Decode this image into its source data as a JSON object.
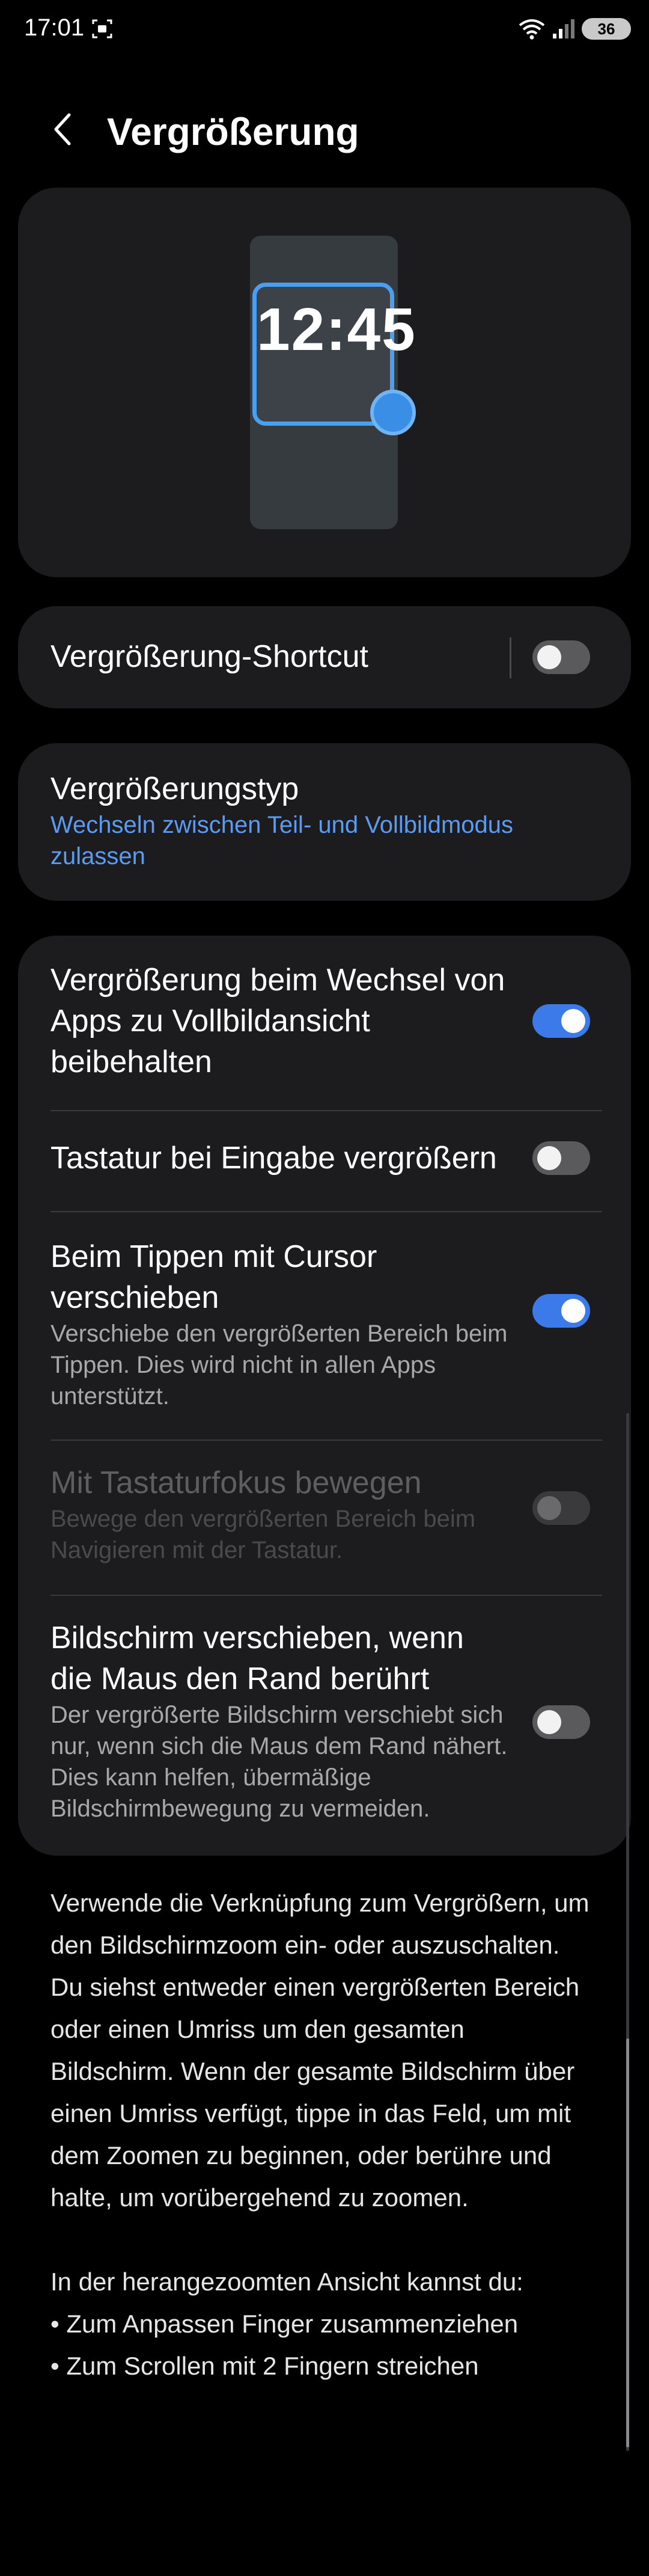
{
  "status": {
    "time": "17:01",
    "battery": "36"
  },
  "header": {
    "title": "Vergrößerung"
  },
  "preview": {
    "time": "12:45"
  },
  "shortcut": {
    "label": "Vergrößerung-Shortcut",
    "enabled": false
  },
  "type": {
    "title": "Vergrößerungstyp",
    "subtitle": "Wechseln zwischen Teil- und Vollbildmodus zulassen"
  },
  "settings": [
    {
      "title": "Vergrößerung beim Wechsel von Apps zu Vollbildansicht beibehalten",
      "subtitle": "",
      "enabled": true,
      "disabled": false
    },
    {
      "title": "Tastatur bei Eingabe vergrößern",
      "subtitle": "",
      "enabled": false,
      "disabled": false
    },
    {
      "title": "Beim Tippen mit Cursor verschieben",
      "subtitle": "Verschiebe den vergrößerten Bereich beim Tippen. Dies wird nicht in allen Apps unterstützt.",
      "enabled": true,
      "disabled": false
    },
    {
      "title": "Mit Tastaturfokus bewegen",
      "subtitle": "Bewege den vergrößerten Bereich beim Navigieren mit der Tastatur.",
      "enabled": false,
      "disabled": true
    },
    {
      "title": "Bildschirm verschieben, wenn die Maus den Rand berührt",
      "subtitle": "Der vergrößerte Bildschirm verschiebt sich nur, wenn sich die Maus dem Rand nähert. Dies kann helfen, übermäßige Bildschirmbewegung zu vermeiden.",
      "enabled": false,
      "disabled": false
    }
  ],
  "description": {
    "paragraph1": "Verwende die Verknüpfung zum Vergrößern, um den Bildschirmzoom ein- oder auszuschalten. Du siehst entweder einen vergrößerten Bereich oder einen Umriss um den gesamten Bildschirm. Wenn der gesamte Bildschirm über einen Umriss verfügt, tippe in das Feld, um mit dem Zoomen zu beginnen, oder berühre und halte, um vorübergehend zu zoomen.",
    "paragraph2": "In der herangezoomten Ansicht kannst du:",
    "bullet1": "• Zum Anpassen Finger zusammenziehen",
    "bullet2": "• Zum Scrollen mit 2 Fingern streichen"
  },
  "colors": {
    "accent": "#3b7ae8",
    "link": "#5b9bf2",
    "card": "#1c1c1e"
  }
}
